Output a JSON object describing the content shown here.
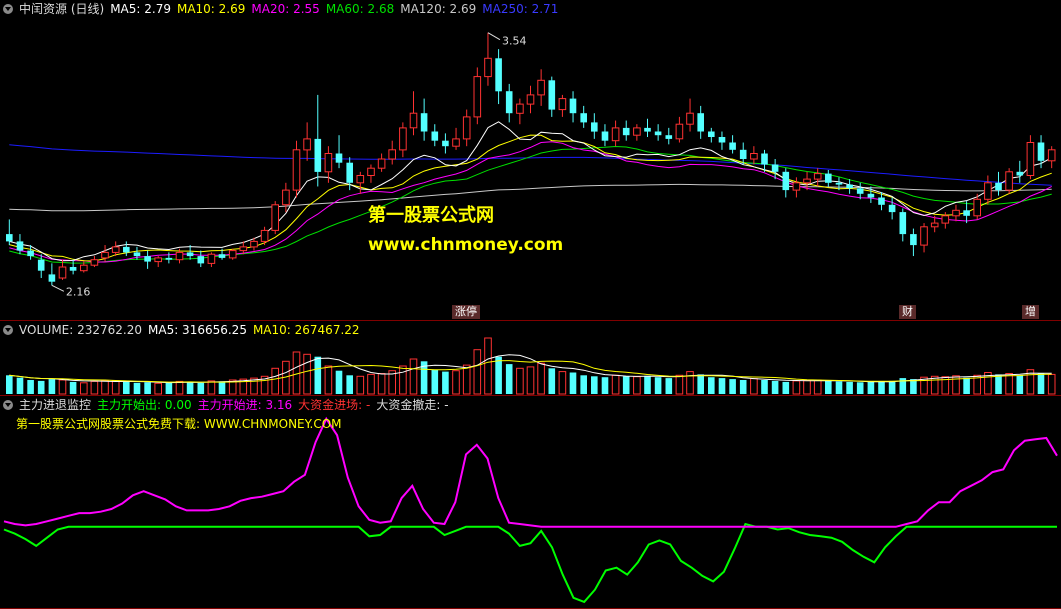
{
  "main_header": {
    "title": "中闰资源 (日线)",
    "ma5": "MA5: 2.79",
    "ma10": "MA10: 2.69",
    "ma20": "MA20: 2.55",
    "ma60": "MA60: 2.68",
    "ma120": "MA120: 2.69",
    "ma250": "MA250: 2.71"
  },
  "volume_header": {
    "volume": "VOLUME: 232762.20",
    "ma5": "MA5: 316656.25",
    "ma10": "MA10: 267467.22"
  },
  "indicator_header": {
    "name": "主力进退监控",
    "out": "主力开始出: 0.00",
    "in": "主力开始进: 3.16",
    "enter": "大资金进场: -",
    "leave": "大资金撤走: -"
  },
  "indicator_note": "第一股票公式网股票公式免费下载: WWW.CHNMONEY.COM",
  "watermark": {
    "line1": "第一股票公式网",
    "line2": "www.chnmoney.com"
  },
  "price_labels": {
    "high": "3.54",
    "low": "2.16"
  },
  "event_tags": [
    "涨停",
    "财",
    "增"
  ],
  "colors": {
    "up": "#ff3232",
    "down": "#54ffff",
    "ma5": "#ffffff",
    "ma10": "#ffff00",
    "ma20": "#ff00ff",
    "ma60": "#00e000",
    "ma120": "#c8c8c8",
    "ma250": "#1c1cff",
    "grid": "#800000",
    "indicator_magenta": "#ff00ff",
    "indicator_green": "#00ff00"
  },
  "chart_data": {
    "type": "candlestick",
    "candles": [
      [
        2.44,
        2.52,
        2.4,
        2.38
      ],
      [
        2.4,
        2.44,
        2.35,
        2.33
      ],
      [
        2.35,
        2.38,
        2.32,
        2.3
      ],
      [
        2.3,
        2.33,
        2.24,
        2.2
      ],
      [
        2.22,
        2.28,
        2.18,
        2.16
      ],
      [
        2.2,
        2.3,
        2.26,
        2.19
      ],
      [
        2.26,
        2.3,
        2.24,
        2.22
      ],
      [
        2.24,
        2.29,
        2.27,
        2.23
      ],
      [
        2.27,
        2.32,
        2.3,
        2.26
      ],
      [
        2.31,
        2.38,
        2.34,
        2.29
      ],
      [
        2.34,
        2.4,
        2.37,
        2.32
      ],
      [
        2.37,
        2.4,
        2.34,
        2.32
      ],
      [
        2.34,
        2.37,
        2.32,
        2.3
      ],
      [
        2.32,
        2.35,
        2.29,
        2.25
      ],
      [
        2.29,
        2.32,
        2.31,
        2.26
      ],
      [
        2.31,
        2.34,
        2.3,
        2.28
      ],
      [
        2.3,
        2.36,
        2.34,
        2.28
      ],
      [
        2.34,
        2.38,
        2.32,
        2.3
      ],
      [
        2.32,
        2.35,
        2.28,
        2.26
      ],
      [
        2.28,
        2.34,
        2.33,
        2.26
      ],
      [
        2.33,
        2.36,
        2.31,
        2.3
      ],
      [
        2.31,
        2.36,
        2.35,
        2.3
      ],
      [
        2.35,
        2.4,
        2.37,
        2.33
      ],
      [
        2.37,
        2.42,
        2.4,
        2.35
      ],
      [
        2.4,
        2.48,
        2.46,
        2.38
      ],
      [
        2.46,
        2.62,
        2.6,
        2.44
      ],
      [
        2.6,
        2.72,
        2.68,
        2.56
      ],
      [
        2.68,
        2.95,
        2.9,
        2.64
      ],
      [
        2.9,
        3.05,
        2.96,
        2.84
      ],
      [
        2.96,
        3.2,
        2.78,
        2.7
      ],
      [
        2.78,
        2.92,
        2.88,
        2.72
      ],
      [
        2.88,
        2.98,
        2.83,
        2.8
      ],
      [
        2.83,
        2.86,
        2.72,
        2.68
      ],
      [
        2.72,
        2.78,
        2.76,
        2.66
      ],
      [
        2.76,
        2.82,
        2.8,
        2.72
      ],
      [
        2.8,
        2.88,
        2.85,
        2.78
      ],
      [
        2.85,
        2.95,
        2.9,
        2.82
      ],
      [
        2.9,
        3.05,
        3.02,
        2.86
      ],
      [
        3.02,
        3.22,
        3.1,
        2.98
      ],
      [
        3.1,
        3.18,
        3.0,
        2.95
      ],
      [
        3.0,
        3.04,
        2.95,
        2.92
      ],
      [
        2.95,
        2.99,
        2.92,
        2.88
      ],
      [
        2.92,
        3.02,
        2.96,
        2.9
      ],
      [
        2.96,
        3.12,
        3.08,
        2.92
      ],
      [
        3.08,
        3.35,
        3.3,
        3.04
      ],
      [
        3.3,
        3.54,
        3.4,
        3.25
      ],
      [
        3.4,
        3.45,
        3.22,
        3.15
      ],
      [
        3.22,
        3.26,
        3.1,
        3.05
      ],
      [
        3.1,
        3.18,
        3.15,
        3.04
      ],
      [
        3.15,
        3.25,
        3.2,
        3.1
      ],
      [
        3.2,
        3.34,
        3.28,
        3.14
      ],
      [
        3.28,
        3.3,
        3.12,
        3.08
      ],
      [
        3.12,
        3.2,
        3.18,
        3.08
      ],
      [
        3.18,
        3.22,
        3.1,
        3.05
      ],
      [
        3.1,
        3.14,
        3.05,
        3.02
      ],
      [
        3.05,
        3.1,
        3.0,
        2.96
      ],
      [
        3.0,
        3.04,
        2.95,
        2.92
      ],
      [
        2.95,
        3.06,
        3.02,
        2.92
      ],
      [
        3.02,
        3.06,
        2.98,
        2.95
      ],
      [
        2.98,
        3.04,
        3.02,
        2.95
      ],
      [
        3.02,
        3.07,
        3.0,
        2.97
      ],
      [
        3.0,
        3.04,
        2.98,
        2.95
      ],
      [
        2.98,
        3.02,
        2.96,
        2.93
      ],
      [
        2.96,
        3.08,
        3.04,
        2.94
      ],
      [
        3.04,
        3.18,
        3.1,
        3.0
      ],
      [
        3.1,
        3.14,
        3.0,
        2.96
      ],
      [
        3.0,
        3.02,
        2.97,
        2.94
      ],
      [
        2.97,
        3.0,
        2.94,
        2.9
      ],
      [
        2.94,
        2.98,
        2.9,
        2.88
      ],
      [
        2.9,
        2.94,
        2.85,
        2.82
      ],
      [
        2.85,
        2.92,
        2.88,
        2.82
      ],
      [
        2.88,
        2.9,
        2.82,
        2.78
      ],
      [
        2.82,
        2.85,
        2.78,
        2.74
      ],
      [
        2.78,
        2.8,
        2.68,
        2.64
      ],
      [
        2.68,
        2.75,
        2.72,
        2.64
      ],
      [
        2.72,
        2.78,
        2.74,
        2.68
      ],
      [
        2.74,
        2.8,
        2.77,
        2.7
      ],
      [
        2.77,
        2.79,
        2.72,
        2.7
      ],
      [
        2.72,
        2.75,
        2.71,
        2.68
      ],
      [
        2.71,
        2.74,
        2.69,
        2.66
      ],
      [
        2.69,
        2.72,
        2.66,
        2.63
      ],
      [
        2.66,
        2.7,
        2.64,
        2.61
      ],
      [
        2.64,
        2.67,
        2.6,
        2.57
      ],
      [
        2.6,
        2.64,
        2.56,
        2.52
      ],
      [
        2.56,
        2.58,
        2.44,
        2.4
      ],
      [
        2.44,
        2.47,
        2.38,
        2.32
      ],
      [
        2.38,
        2.5,
        2.48,
        2.34
      ],
      [
        2.48,
        2.54,
        2.5,
        2.45
      ],
      [
        2.5,
        2.56,
        2.54,
        2.47
      ],
      [
        2.54,
        2.6,
        2.57,
        2.51
      ],
      [
        2.57,
        2.62,
        2.54,
        2.5
      ],
      [
        2.54,
        2.66,
        2.63,
        2.52
      ],
      [
        2.63,
        2.76,
        2.72,
        2.6
      ],
      [
        2.72,
        2.78,
        2.68,
        2.65
      ],
      [
        2.68,
        2.8,
        2.78,
        2.66
      ],
      [
        2.78,
        2.84,
        2.76,
        2.72
      ],
      [
        2.76,
        2.98,
        2.94,
        2.74
      ],
      [
        2.94,
        2.98,
        2.84,
        2.8
      ],
      [
        2.84,
        2.92,
        2.9,
        2.8
      ]
    ],
    "ma_ranges": {
      "ma5": [
        2.4,
        2.79
      ],
      "ma10": [
        2.35,
        2.69
      ],
      "ma20": [
        2.3,
        2.55
      ],
      "ma60": [
        2.25,
        2.68
      ],
      "ma120": [
        2.6,
        2.69
      ],
      "ma250": [
        3.0,
        2.71
      ]
    },
    "volume": [
      40,
      35,
      30,
      28,
      32,
      30,
      26,
      24,
      27,
      29,
      28,
      26,
      24,
      25,
      23,
      24,
      27,
      26,
      24,
      28,
      27,
      30,
      32,
      34,
      38,
      55,
      70,
      90,
      85,
      80,
      60,
      50,
      40,
      38,
      42,
      44,
      50,
      60,
      75,
      70,
      52,
      48,
      50,
      62,
      95,
      120,
      80,
      64,
      55,
      58,
      66,
      55,
      48,
      46,
      40,
      38,
      36,
      40,
      38,
      37,
      39,
      36,
      34,
      40,
      48,
      42,
      36,
      34,
      32,
      30,
      33,
      30,
      28,
      26,
      28,
      29,
      30,
      28,
      27,
      26,
      25,
      26,
      27,
      28,
      34,
      32,
      36,
      38,
      37,
      39,
      35,
      40,
      46,
      42,
      44,
      40,
      52,
      45,
      42
    ],
    "indicator_magenta": [
      0.4,
      0.2,
      0.1,
      0.2,
      0.4,
      0.6,
      0.8,
      1.0,
      1.0,
      1.1,
      1.3,
      1.7,
      2.3,
      2.6,
      2.3,
      2.0,
      1.5,
      1.2,
      1.2,
      1.2,
      1.3,
      1.5,
      1.9,
      2.1,
      2.2,
      2.4,
      2.6,
      3.3,
      3.8,
      6.2,
      7.9,
      6.7,
      3.6,
      1.5,
      0.5,
      0.3,
      0.4,
      2.1,
      3.0,
      1.3,
      0.3,
      0.2,
      1.8,
      5.3,
      6.0,
      5.0,
      2.1,
      0.3,
      0.2,
      0.1,
      0,
      0,
      0,
      0,
      0,
      0,
      0,
      0,
      0,
      0,
      0,
      0,
      0,
      0,
      0,
      0,
      0,
      0,
      0,
      0,
      0,
      0,
      0,
      0,
      0,
      0,
      0,
      0,
      0,
      0,
      0,
      0,
      0,
      0,
      0.2,
      0.4,
      1.2,
      1.8,
      1.8,
      2.6,
      3.0,
      3.4,
      4.0,
      4.2,
      5.6,
      6.3,
      6.4,
      6.5,
      5.2
    ],
    "indicator_green": [
      -0.2,
      -0.5,
      -0.9,
      -1.4,
      -0.8,
      -0.2,
      0,
      0,
      0,
      0,
      0,
      0,
      0,
      0,
      0,
      0,
      0,
      0,
      0,
      0,
      0,
      0,
      0,
      0,
      0,
      0,
      0,
      0,
      0,
      0,
      0,
      0,
      0,
      0,
      -0.7,
      -0.6,
      0,
      0,
      0,
      0,
      0,
      -0.6,
      -0.3,
      0,
      0,
      0,
      0,
      -0.5,
      -1.4,
      -1.2,
      -0.3,
      -1.5,
      -3.5,
      -5.2,
      -5.5,
      -4.6,
      -3.2,
      -3.0,
      -3.5,
      -2.6,
      -1.3,
      -1.0,
      -1.3,
      -2.5,
      -3.0,
      -3.6,
      -4.0,
      -3.3,
      -1.6,
      0.2,
      0,
      0,
      -0.2,
      -0.1,
      -0.4,
      -0.6,
      -0.7,
      -0.8,
      -1.1,
      -1.7,
      -2.2,
      -2.6,
      -1.5,
      -0.7,
      0,
      0,
      0,
      0,
      0,
      0,
      0,
      0,
      0,
      0,
      0,
      0,
      0,
      0,
      0
    ],
    "price_range": [
      2.08,
      3.62
    ],
    "indicator_range": [
      -5.8,
      8.4
    ]
  }
}
